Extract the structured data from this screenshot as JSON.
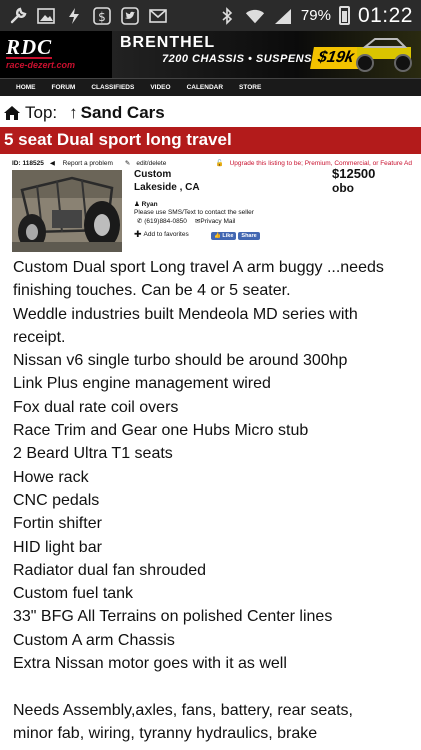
{
  "status_bar": {
    "left_icons": [
      "wrench-icon",
      "image-icon",
      "bolt-icon",
      "dollar-icon",
      "twitter-icon",
      "mail-icon"
    ],
    "battery": "79%",
    "time": "01:22"
  },
  "banner": {
    "logo_main": "RDC",
    "logo_sub": "race-dezert.com",
    "ad_brand": "BRENTHEL",
    "ad_line": "7200 CHASSIS • SUSPENSION",
    "ad_price": "$19k"
  },
  "nav": [
    "HOME",
    "FORUM",
    "CLASSIFIEDS",
    "VIDEO",
    "CALENDAR",
    "STORE"
  ],
  "breadcrumb": {
    "top_label": "Top:",
    "category_label": "Sand Cars"
  },
  "listing": {
    "title": "5 seat Dual sport long travel",
    "id_label": "ID:",
    "id_value": "118525",
    "report": "Report a problem",
    "edit": "edit/delete",
    "upgrade": "Upgrade this listing to be; Premium, Commercial, or Feature Ad",
    "type": "Custom",
    "location": "Lakeside , CA",
    "seller": "Ryan",
    "contact_note": "Please use SMS/Text to contact the seller",
    "phone": "(619)884-0850",
    "privacy_mail": "Privacy Mail",
    "favorites": "Add to favorites",
    "price": "$12500",
    "price_note": "obo",
    "fb_like": "Like",
    "fb_share": "Share"
  },
  "description": [
    "Custom Dual sport Long travel A arm buggy ...needs",
    "finishing touches. Can be 4 or 5 seater.",
    "Weddle industries built Mendeola MD series with",
    "receipt.",
    "Nissan v6 single turbo should be around 300hp",
    "Link Plus engine management wired",
    "Fox dual rate coil overs",
    "Race Trim and Gear one Hubs Micro stub",
    "2 Beard Ultra T1 seats",
    "Howe rack",
    "CNC pedals",
    "Fortin shifter",
    "HID light bar",
    "Radiator dual fan shrouded",
    "Custom fuel tank",
    "33\" BFG All Terrains on polished Center lines",
    "Custom A arm Chassis",
    "Extra Nissan motor goes with it as well",
    "",
    "Needs Assembly,axles, fans, battery, rear seats,",
    "minor fab, wiring, tyranny hydraulics, brake"
  ]
}
